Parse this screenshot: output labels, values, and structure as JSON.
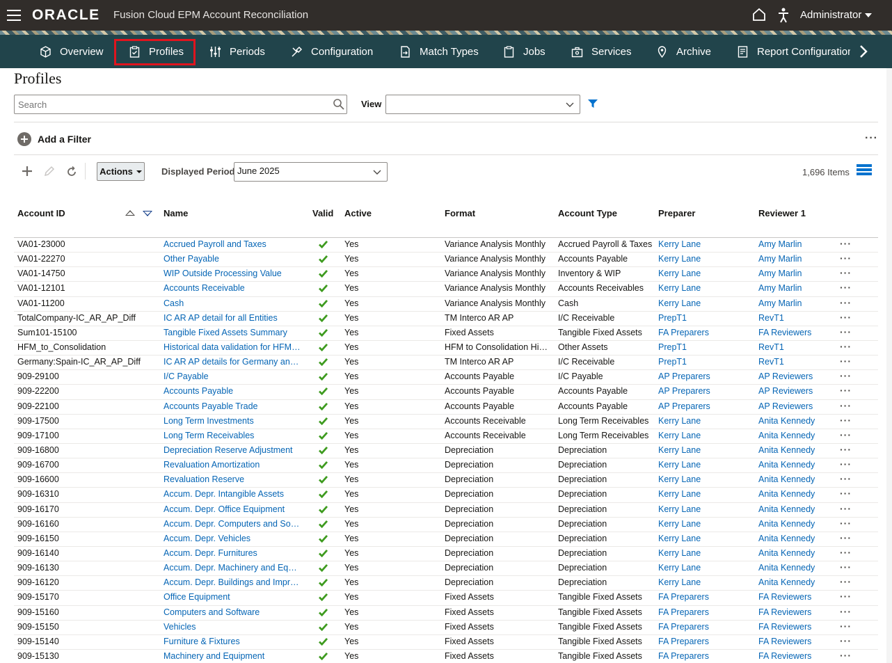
{
  "header": {
    "logo": "ORACLE",
    "app_title": "Fusion Cloud EPM Account Reconciliation",
    "user": "Administrator"
  },
  "nav": {
    "tabs": [
      {
        "label": "Overview",
        "icon": "cube-icon"
      },
      {
        "label": "Profiles",
        "icon": "clipboard-check-icon",
        "active": true
      },
      {
        "label": "Periods",
        "icon": "sliders-icon"
      },
      {
        "label": "Configuration",
        "icon": "tools-icon"
      },
      {
        "label": "Match Types",
        "icon": "document-arrow-icon"
      },
      {
        "label": "Jobs",
        "icon": "clipboard-icon"
      },
      {
        "label": "Services",
        "icon": "toolbox-icon"
      },
      {
        "label": "Archive",
        "icon": "location-pin-icon"
      },
      {
        "label": "Report Configuration",
        "icon": "report-icon"
      }
    ]
  },
  "page": {
    "title": "Profiles",
    "search_placeholder": "Search",
    "view_label": "View",
    "view_value": "",
    "add_filter": "Add a Filter",
    "actions_label": "Actions",
    "displayed_period_label": "Displayed Period",
    "displayed_period_value": "June 2025",
    "items_count": "1,696 Items"
  },
  "colors": {
    "topbar": "#312d2a",
    "navbar": "#21444b",
    "link": "#0565b5",
    "valid_check": "#3e9b1f",
    "active_tab_outline": "#e0141e"
  },
  "table": {
    "columns": [
      "Account ID",
      "Name",
      "Valid",
      "Active",
      "Format",
      "Account Type",
      "Preparer",
      "Reviewer 1"
    ],
    "rows": [
      [
        "VA01-23000",
        "Accrued Payroll and Taxes",
        "Yes",
        "Variance Analysis Monthly",
        "Accrued Payroll & Taxes",
        "Kerry Lane",
        "Amy Marlin"
      ],
      [
        "VA01-22270",
        "Other Payable",
        "Yes",
        "Variance Analysis Monthly",
        "Accounts Payable",
        "Kerry Lane",
        "Amy Marlin"
      ],
      [
        "VA01-14750",
        "WIP Outside Processing Value",
        "Yes",
        "Variance Analysis Monthly",
        "Inventory & WIP",
        "Kerry Lane",
        "Amy Marlin"
      ],
      [
        "VA01-12101",
        "Accounts Receivable",
        "Yes",
        "Variance Analysis Monthly",
        "Accounts Receivables",
        "Kerry Lane",
        "Amy Marlin"
      ],
      [
        "VA01-11200",
        "Cash",
        "Yes",
        "Variance Analysis Monthly",
        "Cash",
        "Kerry Lane",
        "Amy Marlin"
      ],
      [
        "TotalCompany-IC_AR_AP_Diff",
        "IC AR AP detail for all Entities",
        "Yes",
        "TM Interco AR AP",
        "I/C Receivable",
        "PrepT1",
        "RevT1"
      ],
      [
        "Sum101-15100",
        "Tangible Fixed Assets Summary",
        "Yes",
        "Fixed Assets",
        "Tangible Fixed Assets",
        "FA Preparers",
        "FA Reviewers"
      ],
      [
        "HFM_to_Consolidation",
        "Historical data validation for HFM …",
        "Yes",
        "HFM to Consolidation His…",
        "Other Assets",
        "PrepT1",
        "RevT1"
      ],
      [
        "Germany:Spain-IC_AR_AP_Diff",
        "IC AR AP details for Germany and …",
        "Yes",
        "TM Interco AR AP",
        "I/C Receivable",
        "PrepT1",
        "RevT1"
      ],
      [
        "909-29100",
        "I/C Payable",
        "Yes",
        "Accounts Payable",
        "I/C Payable",
        "AP Preparers",
        "AP Reviewers"
      ],
      [
        "909-22200",
        "Accounts Payable",
        "Yes",
        "Accounts Payable",
        "Accounts Payable",
        "AP Preparers",
        "AP Reviewers"
      ],
      [
        "909-22100",
        "Accounts Payable Trade",
        "Yes",
        "Accounts Payable",
        "Accounts Payable",
        "AP Preparers",
        "AP Reviewers"
      ],
      [
        "909-17500",
        "Long Term Investments",
        "Yes",
        "Accounts Receivable",
        "Long Term Receivables",
        "Kerry Lane",
        "Anita Kennedy"
      ],
      [
        "909-17100",
        "Long Term Receivables",
        "Yes",
        "Accounts Receivable",
        "Long Term Receivables",
        "Kerry Lane",
        "Anita Kennedy"
      ],
      [
        "909-16800",
        "Depreciation Reserve Adjustment",
        "Yes",
        "Depreciation",
        "Depreciation",
        "Kerry Lane",
        "Anita Kennedy"
      ],
      [
        "909-16700",
        "Revaluation Amortization",
        "Yes",
        "Depreciation",
        "Depreciation",
        "Kerry Lane",
        "Anita Kennedy"
      ],
      [
        "909-16600",
        "Revaluation Reserve",
        "Yes",
        "Depreciation",
        "Depreciation",
        "Kerry Lane",
        "Anita Kennedy"
      ],
      [
        "909-16310",
        "Accum. Depr. Intangible Assets",
        "Yes",
        "Depreciation",
        "Depreciation",
        "Kerry Lane",
        "Anita Kennedy"
      ],
      [
        "909-16170",
        "Accum. Depr. Office Equipment",
        "Yes",
        "Depreciation",
        "Depreciation",
        "Kerry Lane",
        "Anita Kennedy"
      ],
      [
        "909-16160",
        "Accum. Depr. Computers and Soft…",
        "Yes",
        "Depreciation",
        "Depreciation",
        "Kerry Lane",
        "Anita Kennedy"
      ],
      [
        "909-16150",
        "Accum. Depr. Vehicles",
        "Yes",
        "Depreciation",
        "Depreciation",
        "Kerry Lane",
        "Anita Kennedy"
      ],
      [
        "909-16140",
        "Accum. Depr. Furnitures",
        "Yes",
        "Depreciation",
        "Depreciation",
        "Kerry Lane",
        "Anita Kennedy"
      ],
      [
        "909-16130",
        "Accum. Depr. Machinery and Equi…",
        "Yes",
        "Depreciation",
        "Depreciation",
        "Kerry Lane",
        "Anita Kennedy"
      ],
      [
        "909-16120",
        "Accum. Depr. Buildings and Impro…",
        "Yes",
        "Depreciation",
        "Depreciation",
        "Kerry Lane",
        "Anita Kennedy"
      ],
      [
        "909-15170",
        "Office Equipment",
        "Yes",
        "Fixed Assets",
        "Tangible Fixed Assets",
        "FA Preparers",
        "FA Reviewers"
      ],
      [
        "909-15160",
        "Computers and Software",
        "Yes",
        "Fixed Assets",
        "Tangible Fixed Assets",
        "FA Preparers",
        "FA Reviewers"
      ],
      [
        "909-15150",
        "Vehicles",
        "Yes",
        "Fixed Assets",
        "Tangible Fixed Assets",
        "FA Preparers",
        "FA Reviewers"
      ],
      [
        "909-15140",
        "Furniture & Fixtures",
        "Yes",
        "Fixed Assets",
        "Tangible Fixed Assets",
        "FA Preparers",
        "FA Reviewers"
      ],
      [
        "909-15130",
        "Machinery and Equipment",
        "Yes",
        "Fixed Assets",
        "Tangible Fixed Assets",
        "FA Preparers",
        "FA Reviewers"
      ]
    ]
  }
}
